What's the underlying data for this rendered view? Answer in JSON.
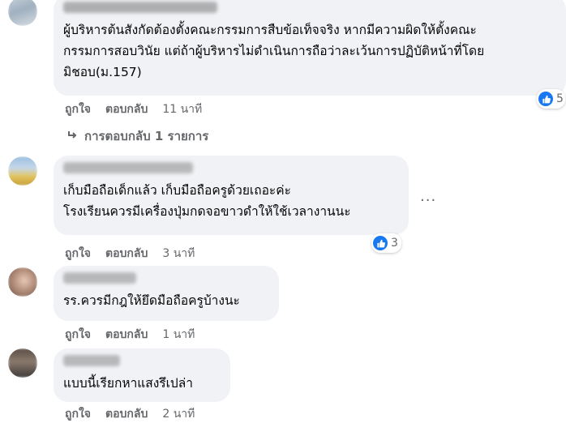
{
  "comments": [
    {
      "text": "ผู้บริหารต้นสังกัดต้องตั้งคณะกรรมการสืบข้อเท็จจริง หากมีความผิดให้ตั้งคณะ\nกรรมการสอบวินัย แต่ถ้าผู้บริหารไม่ดำเนินการถือว่าละเว้นการปฏิบัติหน้าที่โดย\nมิชอบ(ม.157)",
      "like_label": "ถูกใจ",
      "reply_label": "ตอบกลับ",
      "time": "11 นาที",
      "reaction_count": "5",
      "replies_label": "การตอบกลับ 1 รายการ"
    },
    {
      "text": "เก็บมือถือเด็กแล้ว เก็บมือถือครูด้วยเถอะค่ะ\nโรงเรียนควรมีเครื่องปุ่มกดจอขาวดำให้ใช้เวลางานนะ",
      "like_label": "ถูกใจ",
      "reply_label": "ตอบกลับ",
      "time": "3 นาที",
      "reaction_count": "3",
      "more_label": "..."
    },
    {
      "text": "รร.ควรมีกฎให้ยึดมือถือครูบ้างนะ",
      "like_label": "ถูกใจ",
      "reply_label": "ตอบกลับ",
      "time": "1 นาที"
    },
    {
      "text": "แบบนี้เรียกหาแสงรึเปล่า",
      "like_label": "ถูกใจ",
      "reply_label": "ตอบกลับ",
      "time": "2 นาที"
    }
  ],
  "colors": {
    "bubble": "#f0f2f5",
    "action_text": "#65676b",
    "like_blue": "#1877f2"
  },
  "icons": [
    "thumbs-up-icon",
    "reply-arrow-icon",
    "more-options-icon"
  ]
}
